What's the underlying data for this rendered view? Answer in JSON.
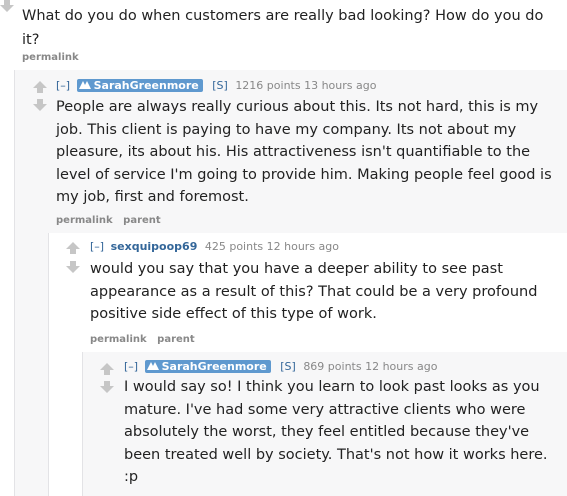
{
  "question": {
    "text": "What do you do when customers are really bad looking? How do you do it?",
    "links": [
      "permalink"
    ]
  },
  "comments": [
    {
      "expand": "[–]",
      "author": "SarahGreenmore",
      "flag": "[S]",
      "score": "1216 points",
      "time": "13 hours ago",
      "body": "People are always really curious about this. Its not hard, this is my job. This client is paying to have my company. Its not about my pleasure, its about his. His attractiveness isn't quantifiable to the level of service I'm going to provide him. Making people feel good is my job, first and foremost.",
      "links": [
        "permalink",
        "parent"
      ]
    },
    {
      "expand": "[–]",
      "author": "sexquipoop69",
      "score": "425 points",
      "time": "12 hours ago",
      "body": "would you say that you have a deeper ability to see past appearance as a result of this? That could be a very profound positive side effect of this type of work.",
      "links": [
        "permalink",
        "parent"
      ]
    },
    {
      "expand": "[–]",
      "author": "SarahGreenmore",
      "flag": "[S]",
      "score": "869 points",
      "time": "12 hours ago",
      "body": "I would say so! I think you learn to look past looks as you mature. I've had some very attractive clients who were absolutely the worst, they feel entitled because they've been treated well by society. That's not how it works here. :p"
    }
  ],
  "colors": {
    "link": "#336699",
    "submitter_badge": "#5f99cf",
    "meta": "#888888",
    "thread_bg": "#f7f7f8"
  }
}
